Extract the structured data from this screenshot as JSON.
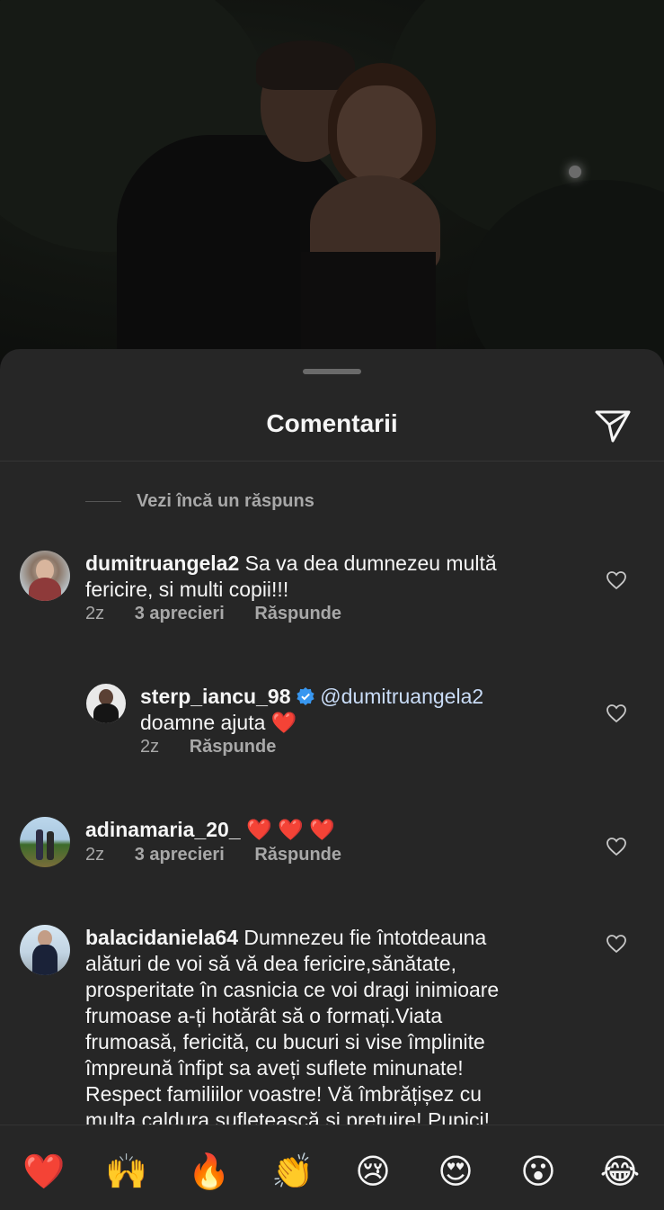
{
  "sheet": {
    "title": "Comentarii",
    "share_icon": "paper-plane-icon",
    "view_more": "Vezi încă un răspuns"
  },
  "comments": [
    {
      "username": "dumitruangela2",
      "text_line1": " Sa va dea dumnezeu multă",
      "text_line2": "fericire, si multi copii!!!",
      "time": "2z",
      "likes": "3 aprecieri",
      "reply": "Răspunde"
    },
    {
      "username": "sterp_iancu_98",
      "verified": true,
      "mention": "@dumitruangela2",
      "text_line2": "doamne ajuta ",
      "emoji": "❤️",
      "time": "2z",
      "reply": "Răspunde"
    },
    {
      "username": "adinamaria_20_",
      "emoji": "❤️ ❤️ ❤️",
      "time": "2z",
      "likes": "3 aprecieri",
      "reply": "Răspunde"
    },
    {
      "username": "balacidaniela64",
      "lines": [
        " Dumnezeu fie întotdeauna",
        "alături de voi să vă dea fericire,sănătate,",
        "prosperitate în casnicia ce voi  dragi inimioare",
        "frumoase a-ți hotărât să o formați.Viata",
        "frumoasă, fericită, cu bucuri si vise împlinite",
        "împreună înfipt sa aveți suflete minunate!",
        "Respect familiilor voastre! Vă îmbrățișez cu",
        "multa caldura sufletească si pretuire! Pupici!"
      ]
    }
  ],
  "quick_reactions": [
    "❤️",
    "🙌",
    "🔥",
    "👏",
    "😢",
    "😍",
    "😮",
    "😂"
  ],
  "colors": {
    "sheet_bg": "#262626",
    "text_primary": "#f5f5f5",
    "text_secondary": "#a8a8a8",
    "verified_blue": "#3897f0",
    "heart_red": "#e0212f"
  }
}
